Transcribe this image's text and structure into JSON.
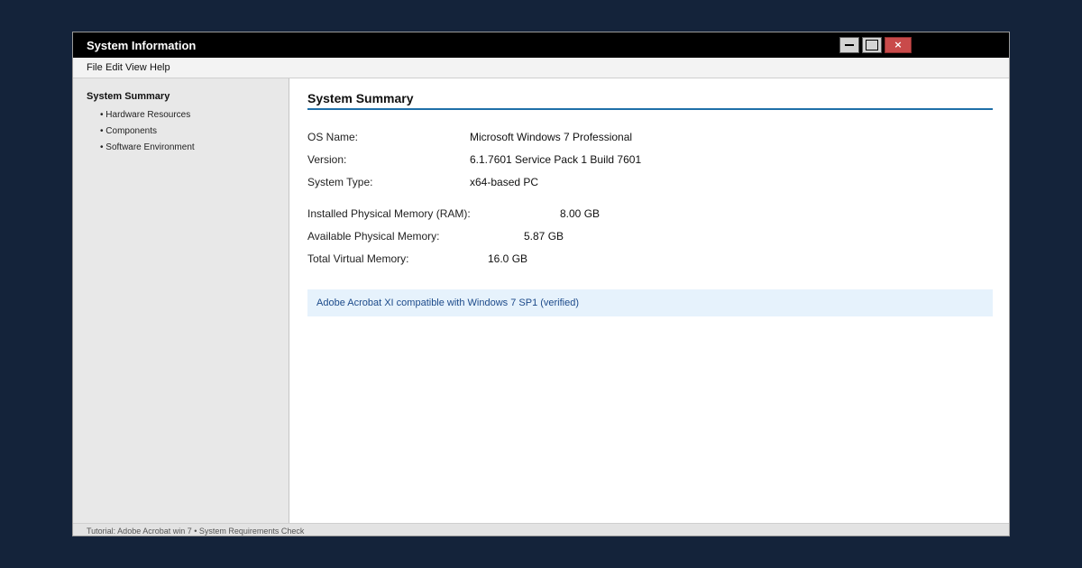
{
  "window": {
    "title": "System Information",
    "close_glyph": "×",
    "controls": [
      "minimize-icon",
      "maximize-icon",
      "close-icon"
    ]
  },
  "menu": [
    "File",
    "Edit",
    "View",
    "Help"
  ],
  "sidebar": {
    "heading": "System Summary",
    "items": [
      {
        "label": "• Hardware Resources"
      },
      {
        "label": "• Components"
      },
      {
        "label": "• Software Environment"
      }
    ]
  },
  "main": {
    "title": "System Summary",
    "system_rows": [
      {
        "label": "OS Name:",
        "value": "Microsoft Windows 7 Professional"
      },
      {
        "label": "Version:",
        "value": "6.1.7601 Service Pack 1 Build 7601"
      },
      {
        "label": "System Type:",
        "value": "x64-based PC"
      }
    ],
    "memory_rows": [
      {
        "label": "Installed Physical Memory (RAM):",
        "value": "8.00 GB"
      },
      {
        "label": "Available Physical Memory:",
        "value": "5.87 GB"
      },
      {
        "label": "Total Virtual Memory:",
        "value": "16.0 GB"
      }
    ],
    "info_banner": "Adobe Acrobat XI compatible with Windows 7 SP1 (verified)"
  },
  "status_bar": "Tutorial: Adobe Acrobat win 7 • System Requirements Check",
  "colors": {
    "titlebar": "#000000",
    "accent_rule": "#1f6fa8",
    "close_button": "#c94a4a",
    "info_background": "#e6f2fc",
    "info_text": "#1c4a8a",
    "desktop": "#14233a"
  }
}
